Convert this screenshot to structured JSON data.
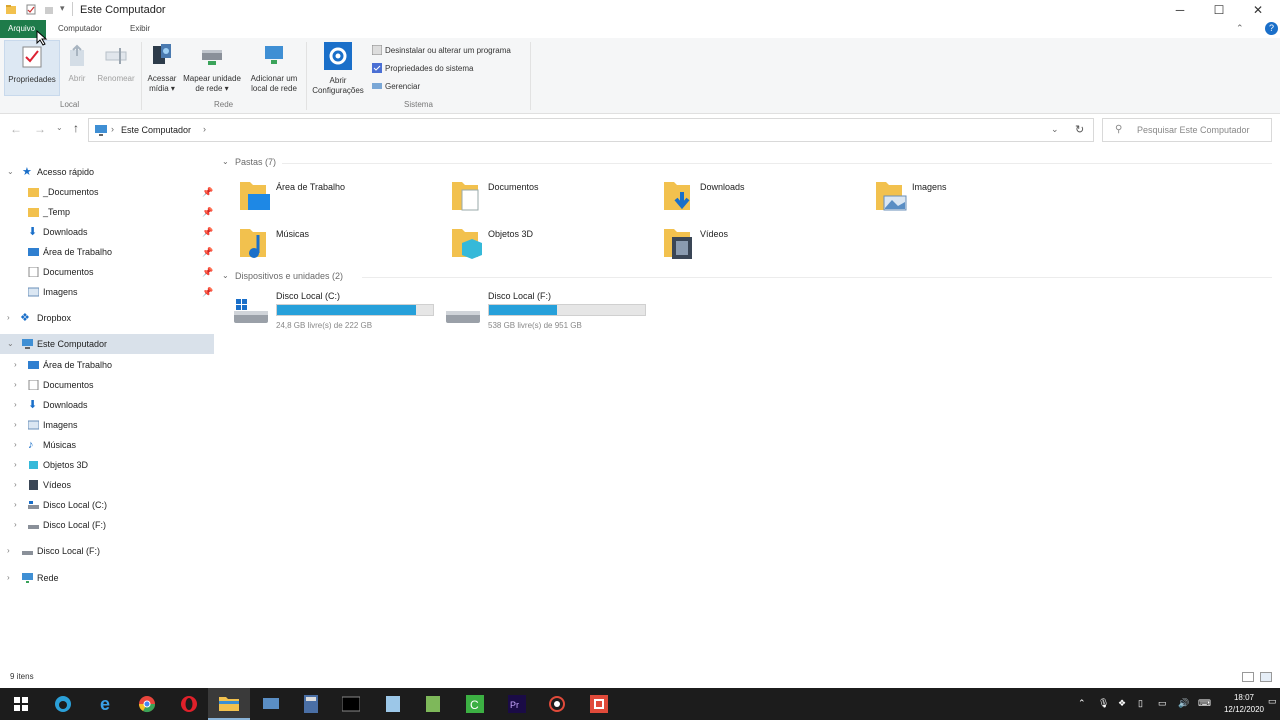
{
  "window": {
    "title": "Este Computador",
    "controls": {
      "minimize": "─",
      "maximize": "☐",
      "close": "✕"
    }
  },
  "ribbon_tabs": [
    {
      "label": "Arquivo"
    },
    {
      "label": "Computador"
    },
    {
      "label": "Exibir"
    }
  ],
  "ribbon": {
    "groups": [
      {
        "label": "Local"
      },
      {
        "label": "Rede"
      },
      {
        "label": "Sistema"
      }
    ],
    "buttons": {
      "propriedades": "Propriedades",
      "abrir": "Abrir",
      "renomear": "Renomear",
      "acessar_midia": "Acessar mídia ▾",
      "mapear_unidade": "Mapear unidade de rede ▾",
      "adicionar_local": "Adicionar um local de rede",
      "abrir_configuracoes": "Abrir Configurações"
    },
    "small_buttons": [
      {
        "label": "Desinstalar ou alterar um programa"
      },
      {
        "label": "Propriedades do sistema"
      },
      {
        "label": "Gerenciar"
      }
    ]
  },
  "address": {
    "path": "Este Computador",
    "search_placeholder": "Pesquisar Este Computador"
  },
  "sidebar": {
    "quick_access": "Acesso rápido",
    "quick_items": [
      {
        "label": "_Documentos"
      },
      {
        "label": "_Temp"
      },
      {
        "label": "Downloads"
      },
      {
        "label": "Área de Trabalho"
      },
      {
        "label": "Documentos"
      },
      {
        "label": "Imagens"
      }
    ],
    "dropbox": "Dropbox",
    "this_pc": "Este Computador",
    "pc_items": [
      {
        "label": "Área de Trabalho"
      },
      {
        "label": "Documentos"
      },
      {
        "label": "Downloads"
      },
      {
        "label": "Imagens"
      },
      {
        "label": "Músicas"
      },
      {
        "label": "Objetos 3D"
      },
      {
        "label": "Vídeos"
      },
      {
        "label": "Disco Local (C:)"
      },
      {
        "label": "Disco Local (F:)"
      }
    ],
    "disk_f": "Disco Local (F:)",
    "network": "Rede"
  },
  "content": {
    "folders_header": "Pastas (7)",
    "folders": [
      {
        "label": "Área de Trabalho"
      },
      {
        "label": "Documentos"
      },
      {
        "label": "Downloads"
      },
      {
        "label": "Imagens"
      },
      {
        "label": "Músicas"
      },
      {
        "label": "Objetos 3D"
      },
      {
        "label": "Vídeos"
      }
    ],
    "devices_header": "Dispositivos e unidades (2)",
    "drives": [
      {
        "name": "Disco Local (C:)",
        "info": "24,8 GB livre(s) de 222 GB",
        "used_fraction": 0.888
      },
      {
        "name": "Disco Local (F:)",
        "info": "538 GB livre(s) de 951 GB",
        "used_fraction": 0.434
      }
    ]
  },
  "status": {
    "item_count": "9 itens"
  },
  "taskbar": {
    "time": "18:07",
    "date": "12/12/2020"
  },
  "colors": {
    "accent": "#26a0da",
    "file_tab": "#1e7b4a",
    "folder": "#f2c14e",
    "taskbar": "#1c1c1c"
  }
}
